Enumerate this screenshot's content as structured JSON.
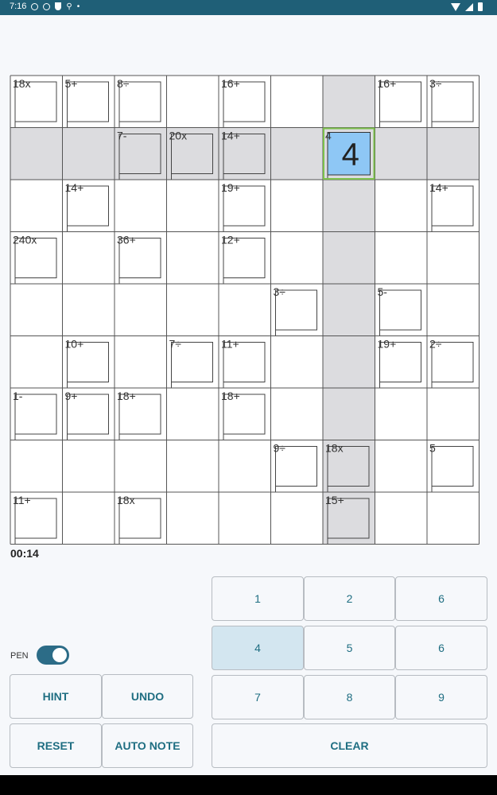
{
  "status_bar": {
    "time": "7:16",
    "left_icons": [
      "info-icon",
      "block-icon",
      "shield-icon",
      "mic-icon",
      "dot-icon"
    ],
    "right_icons": [
      "wifi-icon",
      "signal-icon",
      "battery-icon"
    ],
    "dot": "•"
  },
  "puzzle": {
    "size": 9,
    "selected_cell": {
      "row": 1,
      "col": 6
    },
    "highlighted_row": 1,
    "highlighted_col": 6,
    "cages": [
      {
        "label": "18x",
        "row": 0,
        "col": 0
      },
      {
        "label": "5+",
        "row": 0,
        "col": 1
      },
      {
        "label": "8÷",
        "row": 0,
        "col": 2
      },
      {
        "label": "16+",
        "row": 0,
        "col": 4
      },
      {
        "label": "16+",
        "row": 0,
        "col": 7
      },
      {
        "label": "3÷",
        "row": 0,
        "col": 8
      },
      {
        "label": "7-",
        "row": 1,
        "col": 2
      },
      {
        "label": "20x",
        "row": 1,
        "col": 3
      },
      {
        "label": "14+",
        "row": 1,
        "col": 4
      },
      {
        "label": "4",
        "row": 1,
        "col": 6
      },
      {
        "label": "14+",
        "row": 2,
        "col": 1
      },
      {
        "label": "19+",
        "row": 2,
        "col": 4
      },
      {
        "label": "14+",
        "row": 2,
        "col": 8
      },
      {
        "label": "240x",
        "row": 3,
        "col": 0
      },
      {
        "label": "36+",
        "row": 3,
        "col": 2
      },
      {
        "label": "12+",
        "row": 3,
        "col": 4
      },
      {
        "label": "3÷",
        "row": 4,
        "col": 5
      },
      {
        "label": "5-",
        "row": 4,
        "col": 7
      },
      {
        "label": "10+",
        "row": 5,
        "col": 1
      },
      {
        "label": "7÷",
        "row": 5,
        "col": 3
      },
      {
        "label": "11+",
        "row": 5,
        "col": 4
      },
      {
        "label": "19+",
        "row": 5,
        "col": 7
      },
      {
        "label": "2÷",
        "row": 5,
        "col": 8
      },
      {
        "label": "1-",
        "row": 6,
        "col": 0
      },
      {
        "label": "9+",
        "row": 6,
        "col": 1
      },
      {
        "label": "18+",
        "row": 6,
        "col": 2
      },
      {
        "label": "18+",
        "row": 6,
        "col": 4
      },
      {
        "label": "9÷",
        "row": 7,
        "col": 5
      },
      {
        "label": "18x",
        "row": 7,
        "col": 6
      },
      {
        "label": "5",
        "row": 7,
        "col": 8
      },
      {
        "label": "11+",
        "row": 8,
        "col": 0
      },
      {
        "label": "18x",
        "row": 8,
        "col": 2
      },
      {
        "label": "15+",
        "row": 8,
        "col": 6
      }
    ],
    "values": [
      {
        "row": 1,
        "col": 6,
        "value": "4"
      }
    ]
  },
  "timer": "00:14",
  "pen": {
    "label": "PEN",
    "on": true
  },
  "buttons": {
    "hint": "HINT",
    "undo": "UNDO",
    "reset": "RESET",
    "auto_note": "AUTO NOTE",
    "clear": "CLEAR"
  },
  "number_pad": [
    "1",
    "2",
    "6",
    "4",
    "5",
    "6",
    "7",
    "8",
    "9"
  ],
  "number_pad_selected": "4",
  "colors": {
    "status_bar": "#1f5f77",
    "accent": "#2c6c87",
    "button_text": "#1f6e82",
    "highlight_gray": "#dcdcdf",
    "selected_cell": "#8ec7f5",
    "selected_border": "#7cc04b"
  }
}
